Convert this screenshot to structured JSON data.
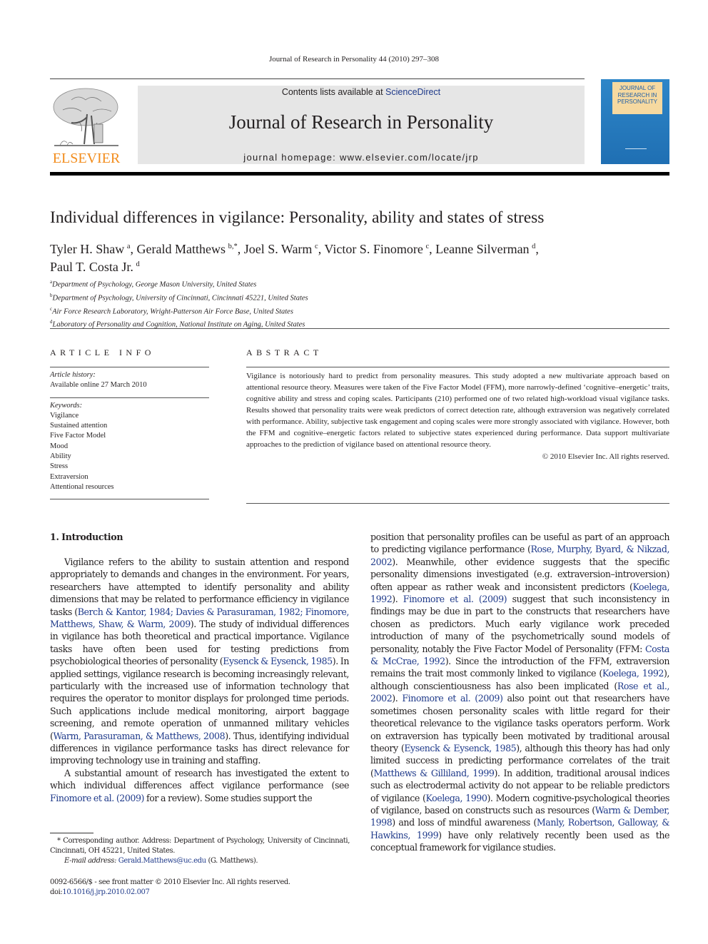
{
  "running_head": "Journal of Research in Personality 44 (2010) 297–308",
  "masthead": {
    "contents_prefix": "Contents lists available at ",
    "contents_link": "ScienceDirect",
    "journal_name": "Journal of Research in Personality",
    "homepage": "journal homepage: www.elsevier.com/locate/jrp",
    "publisher_logo_text": "ELSEVIER",
    "cover_title_lines": [
      "JOURNAL OF",
      "RESEARCH IN",
      "PERSONALITY"
    ],
    "colors": {
      "publisher_orange": "#f28c1c",
      "link_blue": "#1f3a8a",
      "cover_blue": "#2e86c8"
    }
  },
  "article": {
    "title": "Individual differences in vigilance: Personality, ability and states of stress",
    "authors": [
      {
        "name": "Tyler H. Shaw",
        "sup": "a",
        "sep": ", "
      },
      {
        "name": "Gerald Matthews",
        "sup": "b,*",
        "sep": ", "
      },
      {
        "name": "Joel S. Warm",
        "sup": "c",
        "sep": ", "
      },
      {
        "name": "Victor S. Finomore",
        "sup": "c",
        "sep": ", "
      },
      {
        "name": "Leanne Silverman",
        "sup": "d",
        "sep": ","
      },
      {
        "name": "Paul T. Costa Jr.",
        "sup": "d",
        "sep": ""
      }
    ],
    "affiliations": [
      {
        "key": "a",
        "text": "Department of Psychology, George Mason University, United States"
      },
      {
        "key": "b",
        "text": "Department of Psychology, University of Cincinnati, Cincinnati 45221, United States"
      },
      {
        "key": "c",
        "text": "Air Force Research Laboratory, Wright-Patterson Air Force Base, United States"
      },
      {
        "key": "d",
        "text": "Laboratory of Personality and Cognition, National Institute on Aging, United States"
      }
    ]
  },
  "article_info": {
    "heading": "ARTICLE INFO",
    "history_label": "Article history:",
    "history_value": "Available online 27 March 2010",
    "keywords_label": "Keywords:",
    "keywords": [
      "Vigilance",
      "Sustained attention",
      "Five Factor Model",
      "Mood",
      "Ability",
      "Stress",
      "Extraversion",
      "Attentional resources"
    ]
  },
  "abstract": {
    "heading": "ABSTRACT",
    "text": "Vigilance is notoriously hard to predict from personality measures. This study adopted a new multivariate approach based on attentional resource theory. Measures were taken of the Five Factor Model (FFM), more narrowly-defined ‘cognitive–energetic’ traits, cognitive ability and stress and coping scales. Participants (210) performed one of two related high-workload visual vigilance tasks. Results showed that personality traits were weak predictors of correct detection rate, although extraversion was negatively correlated with performance. Ability, subjective task engagement and coping scales were more strongly associated with vigilance. However, both the FFM and cognitive–energetic factors related to subjective states experienced during performance. Data support multivariate approaches to the prediction of vigilance based on attentional resource theory.",
    "copyright": "© 2010 Elsevier Inc. All rights reserved."
  },
  "body": {
    "section_heading": "1. Introduction",
    "left_paragraphs": [
      [
        {
          "t": "Vigilance refers to the ability to sustain attention and respond appropriately to demands and changes in the environment. For years, researchers have attempted to identify personality and ability dimensions that may be related to performance efficiency in vigilance tasks ("
        },
        {
          "t": "Berch & Kantor, 1984; Davies & Parasuraman, 1982; Finomore, Matthews, Shaw, & Warm, 2009",
          "link": true
        },
        {
          "t": "). The study of individual differences in vigilance has both theoretical and practical importance. Vigilance tasks have often been used for testing predictions from psychobiological theories of personality ("
        },
        {
          "t": "Eysenck & Eysenck, 1985",
          "link": true
        },
        {
          "t": "). In applied settings, vigilance research is becoming increasingly relevant, particularly with the increased use of information technology that requires the operator to monitor displays for prolonged time periods. Such applications include medical monitoring, airport baggage screening, and remote operation of unmanned military vehicles ("
        },
        {
          "t": "Warm, Parasuraman, & Matthews, 2008",
          "link": true
        },
        {
          "t": "). Thus, identifying individual differences in vigilance performance tasks has direct relevance for improving technology use in training and staffing."
        }
      ],
      [
        {
          "t": "A substantial amount of research has investigated the extent to which individual differences affect vigilance performance (see "
        },
        {
          "t": "Finomore et al. (2009)",
          "link": true
        },
        {
          "t": " for a review). Some studies support the"
        }
      ]
    ],
    "right_paragraphs": [
      [
        {
          "t": "position that personality profiles can be useful as part of an approach to predicting vigilance performance ("
        },
        {
          "t": "Rose, Murphy, Byard, & Nikzad, 2002",
          "link": true
        },
        {
          "t": "). Meanwhile, other evidence suggests that the specific personality dimensions investigated (e.g. extraversion–introversion) often appear as rather weak and inconsistent predictors ("
        },
        {
          "t": "Koelega, 1992",
          "link": true
        },
        {
          "t": "). "
        },
        {
          "t": "Finomore et al. (2009)",
          "link": true
        },
        {
          "t": " suggest that such inconsistency in findings may be due in part to the constructs that researchers have chosen as predictors. Much early vigilance work preceded introduction of many of the psychometrically sound models of personality, notably the Five Factor Model of Personality (FFM: "
        },
        {
          "t": "Costa & McCrae, 1992",
          "link": true
        },
        {
          "t": "). Since the introduction of the FFM, extraversion remains the trait most commonly linked to vigilance ("
        },
        {
          "t": "Koelega, 1992",
          "link": true
        },
        {
          "t": "), although conscientiousness has also been implicated ("
        },
        {
          "t": "Rose et al., 2002",
          "link": true
        },
        {
          "t": "). "
        },
        {
          "t": "Finomore et al. (2009)",
          "link": true
        },
        {
          "t": " also point out that researchers have sometimes chosen personality scales with little regard for their theoretical relevance to the vigilance tasks operators perform. Work on extraversion has typically been motivated by traditional arousal theory ("
        },
        {
          "t": "Eysenck & Eysenck, 1985",
          "link": true
        },
        {
          "t": "), although this theory has had only limited success in predicting performance correlates of the trait ("
        },
        {
          "t": "Matthews & Gilliland, 1999",
          "link": true
        },
        {
          "t": "). In addition, traditional arousal indices such as electrodermal activity do not appear to be reliable predictors of vigilance ("
        },
        {
          "t": "Koelega, 1990",
          "link": true
        },
        {
          "t": "). Modern cognitive-psychological theories of vigilance, based on constructs such as resources ("
        },
        {
          "t": "Warm & Dember, 1998",
          "link": true
        },
        {
          "t": ") and loss of mindful awareness ("
        },
        {
          "t": "Manly, Robertson, Galloway, & Hawkins, 1999",
          "link": true
        },
        {
          "t": ") have only relatively recently been used as the conceptual framework for vigilance studies."
        }
      ]
    ]
  },
  "footnote": {
    "marker": "*",
    "text": " Corresponding author. Address: Department of Psychology, University of Cincinnati, Cincinnati, OH 45221, United States.",
    "email_label": "E-mail address: ",
    "email": "Gerald.Matthews@uc.edu",
    "email_suffix": " (G. Matthews)."
  },
  "front_matter": {
    "issn_line": "0092-6566/$ - see front matter © 2010 Elsevier Inc. All rights reserved.",
    "doi_prefix": "doi:",
    "doi": "10.1016/j.jrp.2010.02.007"
  }
}
